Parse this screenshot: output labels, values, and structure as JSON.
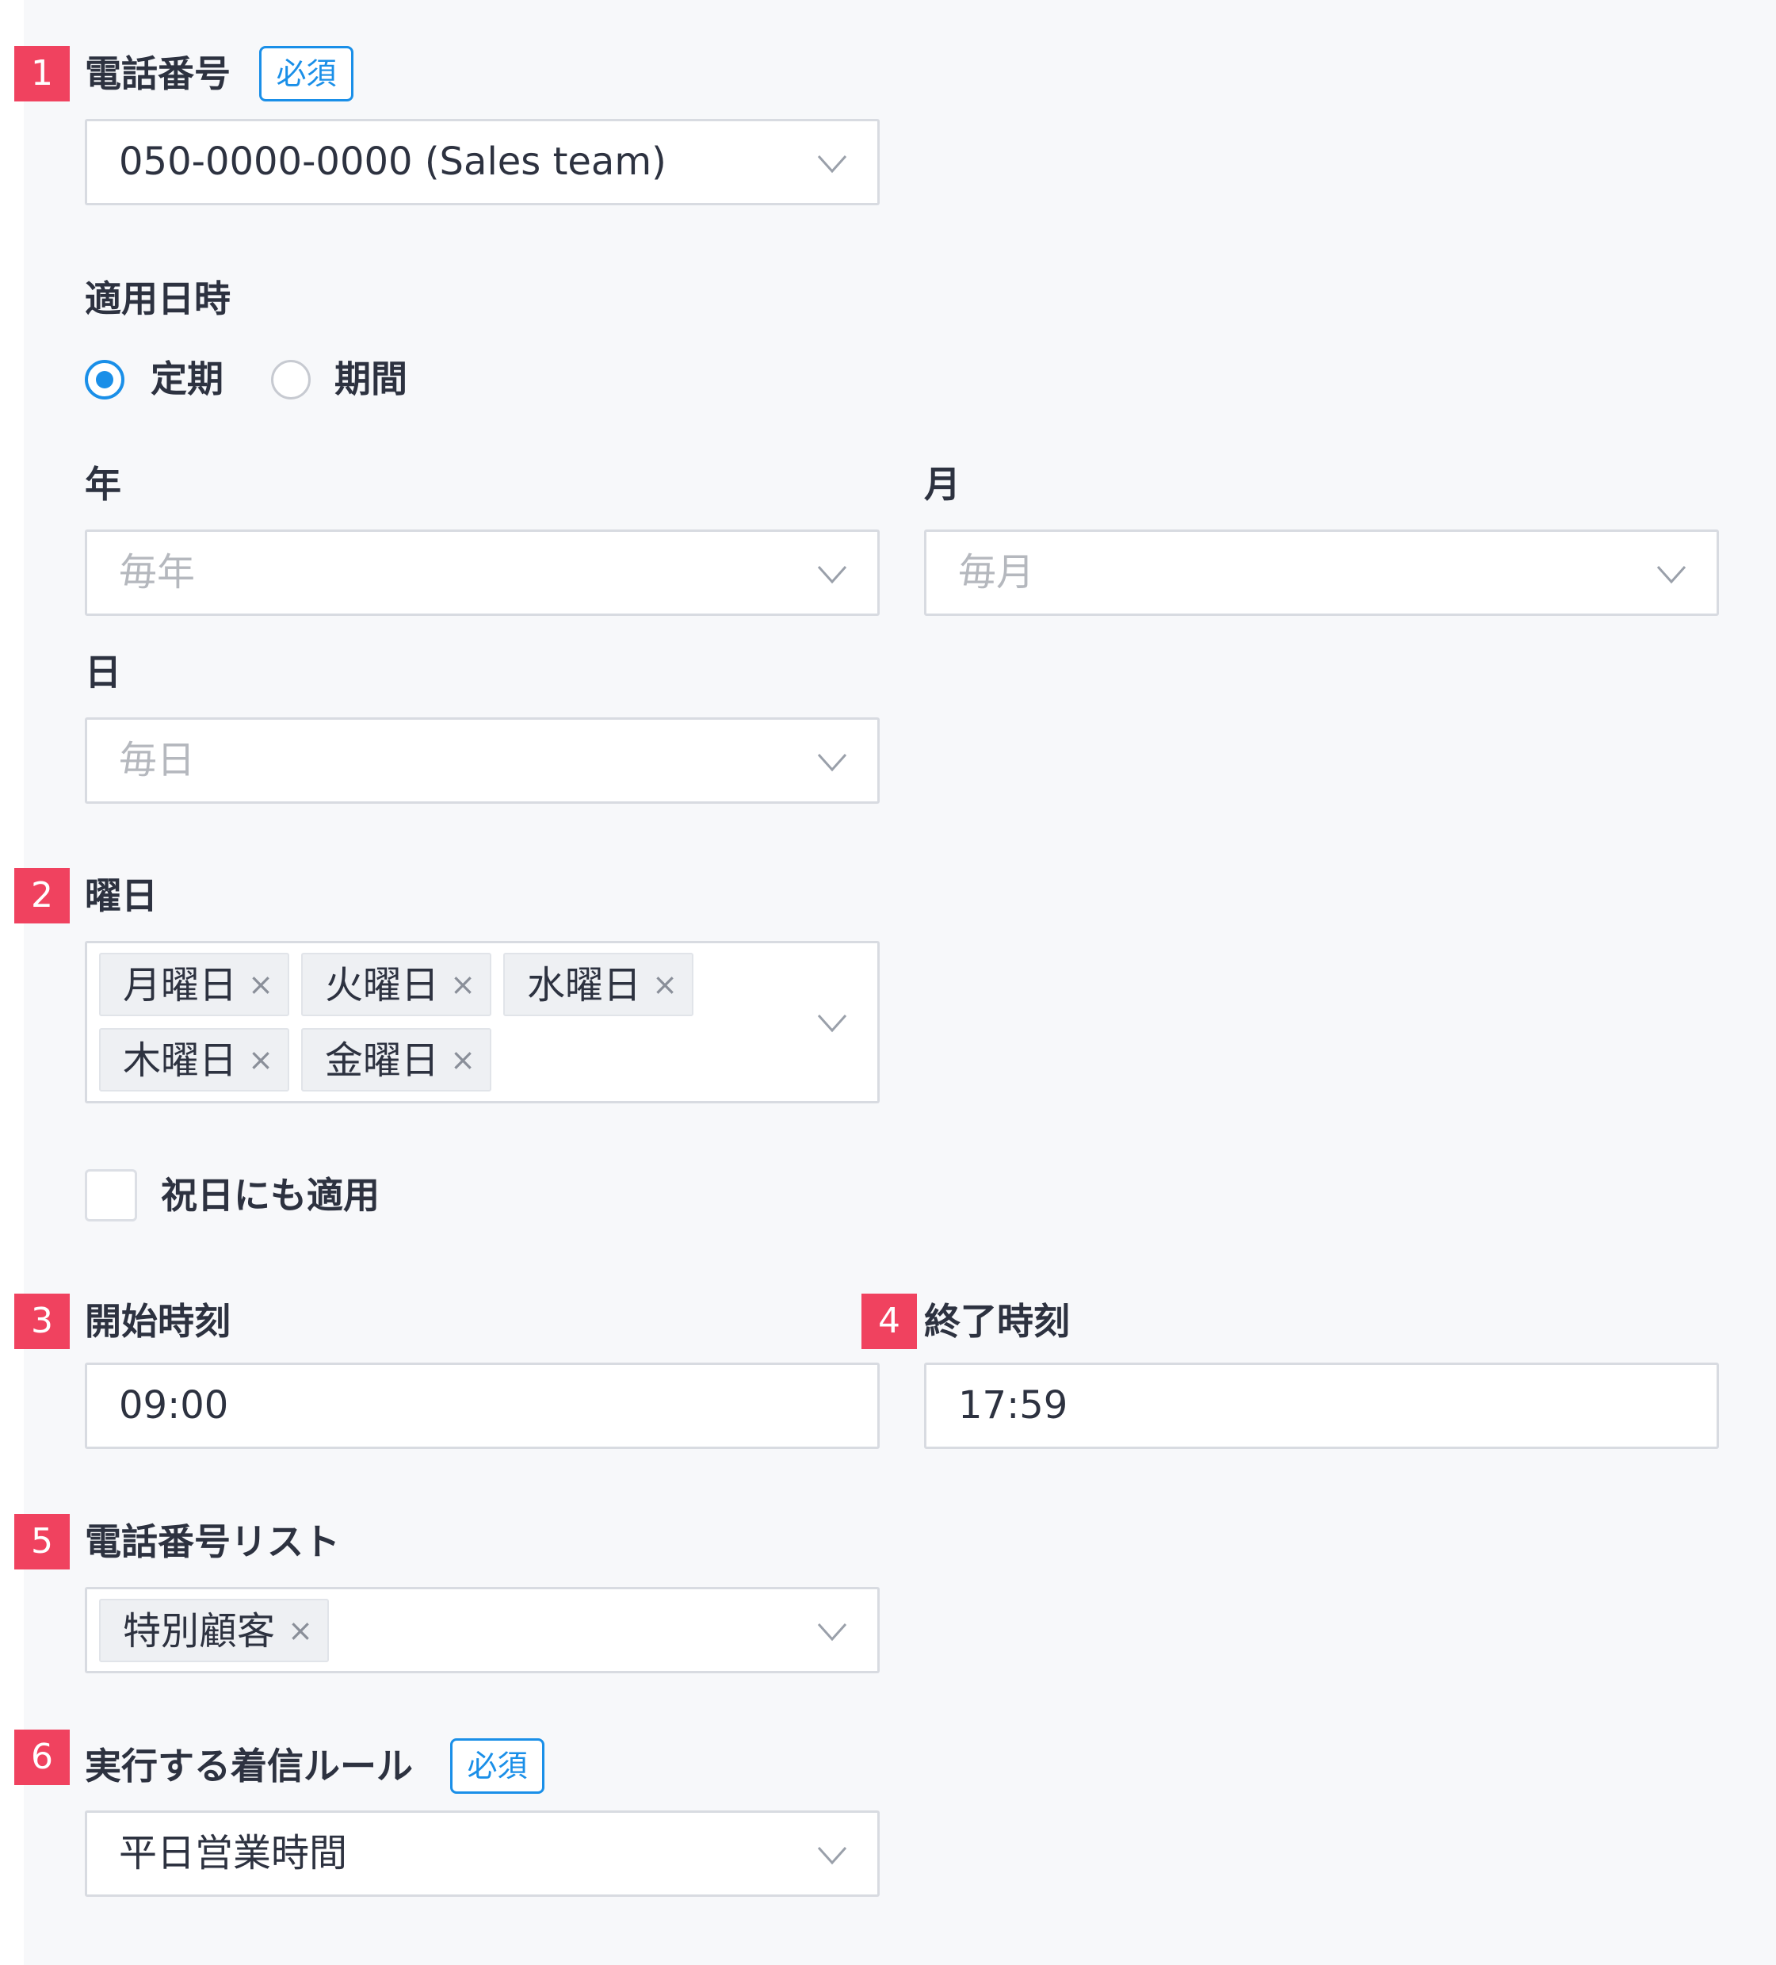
{
  "phone_number": {
    "step": "1",
    "label": "電話番号",
    "required": "必須",
    "value": "050-0000-0000 (Sales team)",
    "icon": "chevron-down-icon"
  },
  "apply_datetime": {
    "label": "適用日時",
    "options": [
      {
        "label": "定期",
        "selected": true
      },
      {
        "label": "期間",
        "selected": false
      }
    ]
  },
  "year": {
    "label": "年",
    "placeholder": "毎年"
  },
  "month": {
    "label": "月",
    "placeholder": "毎月"
  },
  "day": {
    "label": "日",
    "placeholder": "毎日"
  },
  "weekday": {
    "step": "2",
    "label": "曜日",
    "tags": [
      "月曜日",
      "火曜日",
      "水曜日",
      "木曜日",
      "金曜日"
    ],
    "remove_glyph": "×"
  },
  "holiday": {
    "label": "祝日にも適用",
    "checked": false
  },
  "start_time": {
    "step": "3",
    "label": "開始時刻",
    "value": "09:00"
  },
  "end_time": {
    "step": "4",
    "label": "終了時刻",
    "value": "17:59"
  },
  "phone_list": {
    "step": "5",
    "label": "電話番号リスト",
    "tags": [
      "特別顧客"
    ]
  },
  "rule": {
    "step": "6",
    "label": "実行する着信ルール",
    "required": "必須",
    "value": "平日営業時間"
  },
  "colors": {
    "accent": "#1a8fe8",
    "step_badge": "#f0425f",
    "panel_background": "#f7f8fa"
  }
}
